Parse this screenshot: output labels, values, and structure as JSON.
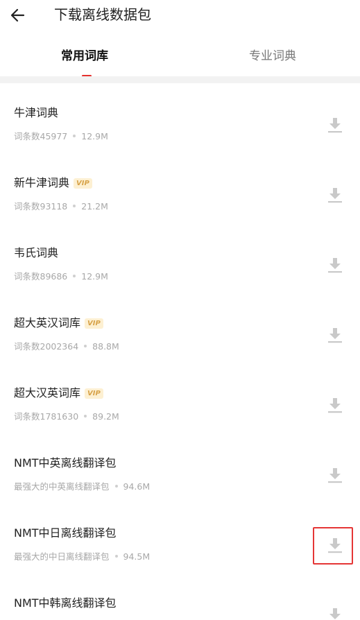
{
  "header": {
    "title": "下载离线数据包"
  },
  "tabs": [
    {
      "label": "常用词库",
      "active": true
    },
    {
      "label": "专业词典",
      "active": false
    }
  ],
  "colors": {
    "accent": "#e5302d",
    "vip_text": "#d7a34a",
    "vip_bg": "#fdf0d2",
    "highlight": "#e53535"
  },
  "items": [
    {
      "name": "牛津词典",
      "vip": false,
      "meta": "词条数45977",
      "size": "12.9M"
    },
    {
      "name": "新牛津词典",
      "vip": true,
      "vip_label": "VIP",
      "meta": "词条数93118",
      "size": "21.2M"
    },
    {
      "name": "韦氏词典",
      "vip": false,
      "meta": "词条数89686",
      "size": "12.9M"
    },
    {
      "name": "超大英汉词库",
      "vip": true,
      "vip_label": "VIP",
      "meta": "词条数2002364",
      "size": "88.8M"
    },
    {
      "name": "超大汉英词库",
      "vip": true,
      "vip_label": "VIP",
      "meta": "词条数1781630",
      "size": "89.2M"
    },
    {
      "name": "NMT中英离线翻译包",
      "vip": false,
      "meta": "最强大的中英离线翻译包",
      "size": "94.6M"
    },
    {
      "name": "NMT中日离线翻译包",
      "vip": false,
      "meta": "最强大的中日离线翻译包",
      "size": "94.5M"
    },
    {
      "name": "NMT中韩离线翻译包",
      "vip": false,
      "meta": "",
      "size": ""
    }
  ],
  "icons": {
    "back": "arrow-left-icon",
    "download": "download-icon"
  }
}
